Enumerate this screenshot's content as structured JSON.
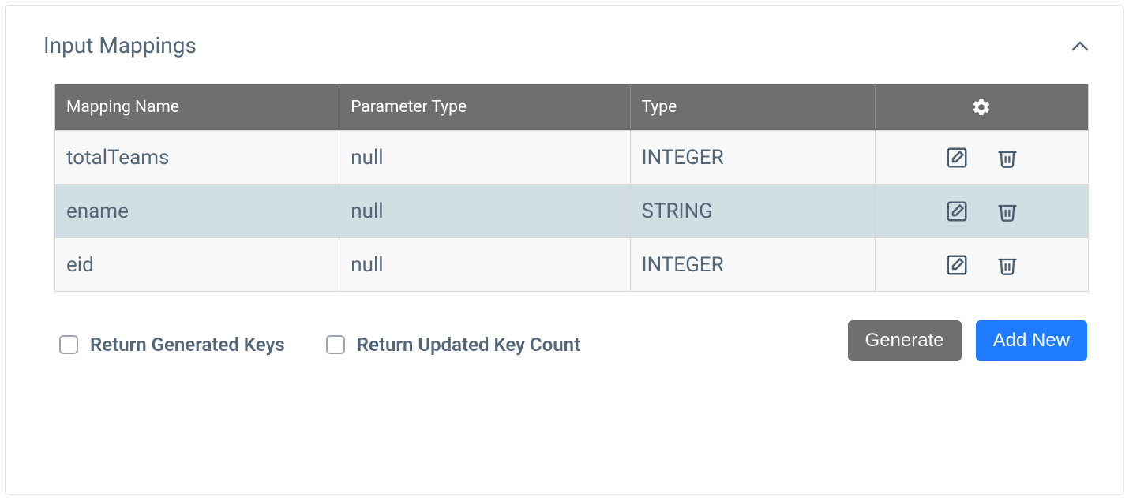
{
  "panel": {
    "title": "Input Mappings"
  },
  "table": {
    "headers": {
      "mapping": "Mapping Name",
      "param": "Parameter Type",
      "type": "Type"
    },
    "rows": [
      {
        "mapping": "totalTeams",
        "param": "null",
        "type": "INTEGER"
      },
      {
        "mapping": "ename",
        "param": "null",
        "type": "STRING"
      },
      {
        "mapping": "eid",
        "param": "null",
        "type": "INTEGER"
      }
    ]
  },
  "buttons": {
    "generate": "Generate",
    "add_new": "Add New"
  },
  "checkboxes": {
    "return_generated_keys": "Return Generated Keys",
    "return_updated_count": "Return Updated Key Count"
  }
}
